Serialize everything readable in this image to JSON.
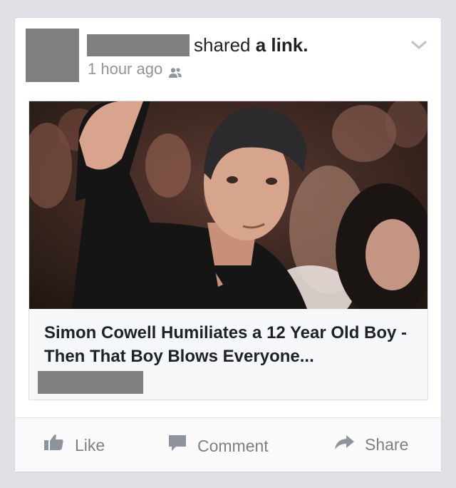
{
  "post": {
    "action_prefix": "shared",
    "action_object": "a link.",
    "timestamp": "1 hour ago",
    "audience_icon": "friends-icon",
    "menu_icon": "chevron-down-icon"
  },
  "link": {
    "title": "Simon Cowell Humiliates a 12 Year Old Boy - Then That Boy Blows Everyone..."
  },
  "actions": [
    {
      "label": "Like",
      "icon": "thumbs-up-icon"
    },
    {
      "label": "Comment",
      "icon": "comment-icon"
    },
    {
      "label": "Share",
      "icon": "share-arrow-icon"
    }
  ],
  "colors": {
    "text_primary": "#1d2129",
    "text_secondary": "#90949c",
    "action_gray": "#7f7f7f",
    "redaction": "#808080"
  }
}
